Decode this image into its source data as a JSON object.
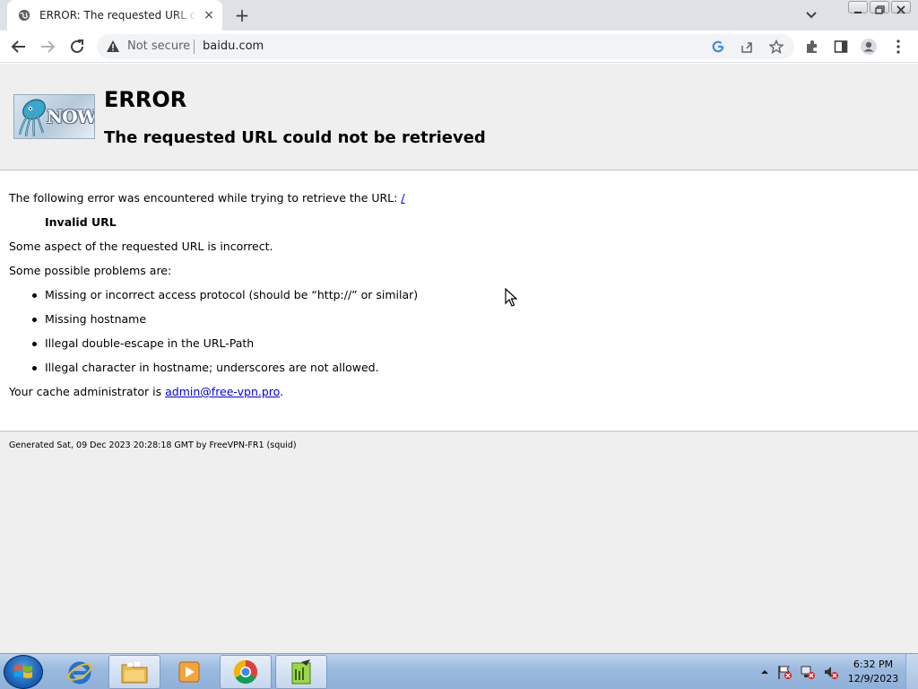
{
  "browser": {
    "tab": {
      "title": "ERROR: The requested URL could not be retrieved",
      "close_glyph": "×"
    },
    "newtab_glyph": "+",
    "omnibox": {
      "security_label": "Not secure",
      "url": "baidu.com"
    }
  },
  "page": {
    "logo_text": "NOW",
    "title": "ERROR",
    "subtitle": "The requested URL could not be retrieved",
    "intro": "The following error was encountered while trying to retrieve the URL: ",
    "intro_link": "/",
    "error_name": "Invalid URL",
    "description": "Some aspect of the requested URL is incorrect.",
    "problems_heading": "Some possible problems are:",
    "problems": [
      "Missing or incorrect access protocol (should be “http://” or similar)",
      "Missing hostname",
      "Illegal double-escape in the URL-Path",
      "Illegal character in hostname; underscores are not allowed."
    ],
    "admin_prefix": "Your cache administrator is ",
    "admin_email": "admin@free-vpn.pro",
    "admin_suffix": ".",
    "footer": "Generated Sat, 09 Dec 2023 20:28:18 GMT by FreeVPN-FR1 (squid)"
  },
  "taskbar": {
    "apps": [
      "internet-explorer",
      "file-explorer",
      "media-player",
      "chrome",
      "notepad-editor"
    ],
    "clock_time": "6:32 PM",
    "clock_date": "12/9/2023"
  },
  "colors": {
    "link": "#0000ee",
    "page_band": "#efefef",
    "tabstrip": "#dee1e6"
  }
}
